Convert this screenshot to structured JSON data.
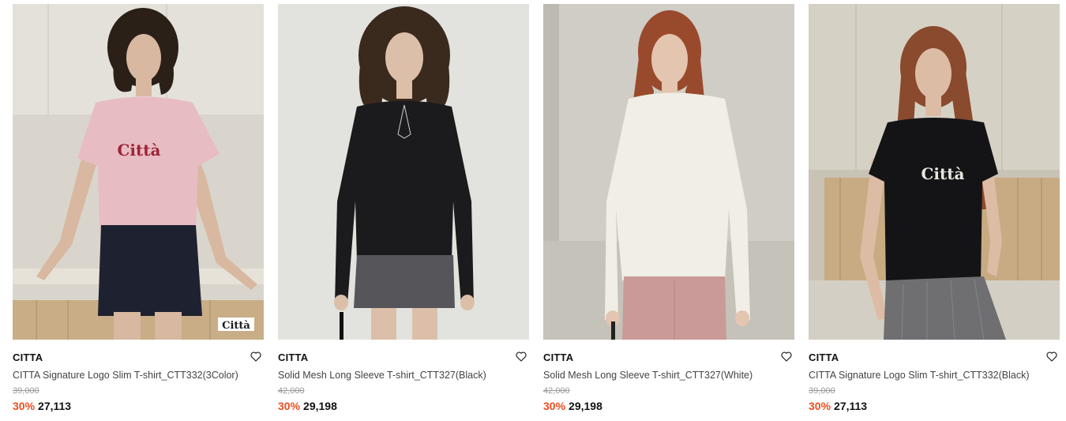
{
  "products": [
    {
      "brand": "CITTA",
      "name": "CITTA Signature Logo Slim T-shirt_CTT332(3Color)",
      "original_price": "39,000",
      "discount": "30%",
      "sale_price": "27,113",
      "image_logo": "Città",
      "colors": {
        "bg": "#d9d5cc",
        "top": "#e8bcc3",
        "bottom": "#1e2230",
        "hair": "#2b2018",
        "skin": "#d8b8a0",
        "print": "#9e2436"
      }
    },
    {
      "brand": "CITTA",
      "name": "Solid Mesh Long Sleeve T-shirt_CTT327(Black)",
      "original_price": "42,000",
      "discount": "30%",
      "sale_price": "29,198",
      "colors": {
        "bg": "#e2e3de",
        "top": "#1b1b1d",
        "bottom": "#55555a",
        "hair": "#3a2a1e",
        "skin": "#dcbfa8"
      }
    },
    {
      "brand": "CITTA",
      "name": "Solid Mesh Long Sleeve T-shirt_CTT327(White)",
      "original_price": "42,000",
      "discount": "30%",
      "sale_price": "29,198",
      "colors": {
        "bg": "#cfcdc6",
        "top": "#f1eee6",
        "bottom": "#c99a98",
        "hair": "#9a4a2c",
        "skin": "#e3c5b0"
      }
    },
    {
      "brand": "CITTA",
      "name": "CITTA Signature Logo Slim T-shirt_CTT332(Black)",
      "original_price": "39,000",
      "discount": "30%",
      "sale_price": "27,113",
      "image_logo": "Città",
      "colors": {
        "bg": "#c9c3b5",
        "top": "#141416",
        "bottom": "#6f6f72",
        "hair": "#8a4a2e",
        "skin": "#dcbca4",
        "print": "#e8e6e0"
      }
    }
  ],
  "icons": {
    "wishlist": "heart-outline-icon"
  },
  "accent": {
    "discount": "#ee4d1f",
    "strike": "#999999"
  }
}
